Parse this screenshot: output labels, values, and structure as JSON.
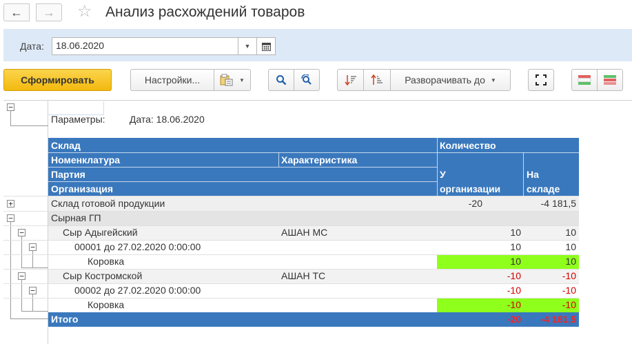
{
  "window": {
    "title": "Анализ расхождений товаров"
  },
  "nav": {
    "back_icon": "←",
    "forward_icon": "→",
    "star_icon": "☆"
  },
  "params": {
    "date_label": "Дата:",
    "date_value": "18.06.2020"
  },
  "toolbar": {
    "generate_label": "Сформировать",
    "settings_label": "Настройки...",
    "expand_label": "Разворачивать до"
  },
  "report": {
    "params_label": "Параметры:",
    "params_value": "Дата: 18.06.2020",
    "headers": {
      "warehouse": "Склад",
      "nomenclature": "Номенклатура",
      "characteristic": "Характеристика",
      "batch": "Партия",
      "organization": "Организация",
      "quantity": "Количество",
      "at_org_1": "У",
      "at_org_2": "организации",
      "in_stock_1": "На",
      "in_stock_2": "складе"
    },
    "rows": [
      {
        "name": "Склад готовой продукции",
        "char": "",
        "org": "-20",
        "stock": "-4 181,5"
      },
      {
        "name": "Сырная ГП",
        "char": "",
        "org": "",
        "stock": ""
      },
      {
        "name": "Сыр Адыгейский",
        "char": "АШАН МС",
        "org": "10",
        "stock": "10"
      },
      {
        "name": "00001 до 27.02.2020 0:00:00",
        "char": "",
        "org": "10",
        "stock": "10"
      },
      {
        "name": "Коровка",
        "char": "",
        "org": "10",
        "stock": "10"
      },
      {
        "name": "Сыр Костромской",
        "char": "АШАН ТС",
        "org": "-10",
        "stock": "-10"
      },
      {
        "name": "00002 до 27.02.2020 0:00:00",
        "char": "",
        "org": "-10",
        "stock": "-10"
      },
      {
        "name": "Коровка",
        "char": "",
        "org": "-10",
        "stock": "-10"
      }
    ],
    "total": {
      "label": "Итого",
      "org": "-20",
      "stock": "-4 181,5"
    }
  },
  "colors": {
    "header_blue": "#3a78bd",
    "highlight_green": "#8fff1c",
    "negative_red": "#d40000",
    "primary_yellow": "#f2b90e"
  }
}
